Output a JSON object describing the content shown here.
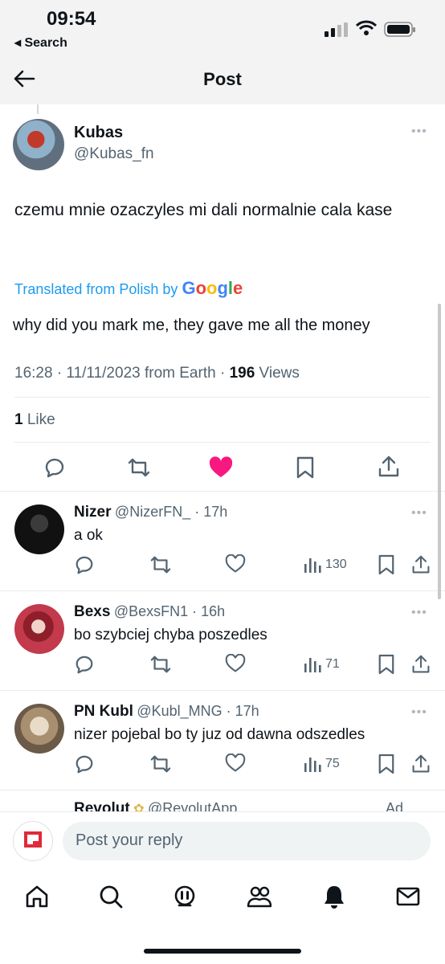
{
  "status_bar": {
    "time": "09:54",
    "back_label": "◂ Search"
  },
  "header": {
    "title": "Post"
  },
  "post": {
    "author_name": "Kubas",
    "author_handle": "@Kubas_fn",
    "text": "czemu mnie ozaczyles mi dali normalnie cala kase",
    "translated_label": "Translated from Polish by",
    "translated_brand": "Google",
    "translation": "why did you mark me, they gave me all the money",
    "meta_time": "16:28 · 11/11/2023 from Earth · ",
    "views_count": "196",
    "views_label": " Views",
    "likes_count": "1",
    "likes_label": " Like",
    "liked": true
  },
  "replies": [
    {
      "name": "Nizer",
      "handle": "@NizerFN_ · 17h",
      "text": "a ok",
      "views": "130"
    },
    {
      "name": "Bexs",
      "handle": "@BexsFN1 · 16h",
      "text": "bo szybciej chyba poszedles",
      "views": "71"
    },
    {
      "name": "PN Kubl",
      "handle": "@Kubl_MNG · 17h",
      "text": "nizer pojebal bo ty juz od dawna odszedles",
      "views": "75"
    },
    {
      "name": "Revolut",
      "handle": "@RevolutApp",
      "ad_label": "Ad"
    }
  ],
  "composer": {
    "placeholder": "Post your reply"
  },
  "colors": {
    "accent": "#1d9bf0",
    "like": "#f91880",
    "text": "#0f1419",
    "muted": "#536471"
  },
  "icons": {
    "nav": [
      "home-icon",
      "search-icon",
      "grok-icon",
      "communities-icon",
      "notifications-icon",
      "messages-icon"
    ],
    "actions": [
      "reply-icon",
      "repost-icon",
      "like-icon",
      "bookmark-icon",
      "share-icon"
    ]
  }
}
